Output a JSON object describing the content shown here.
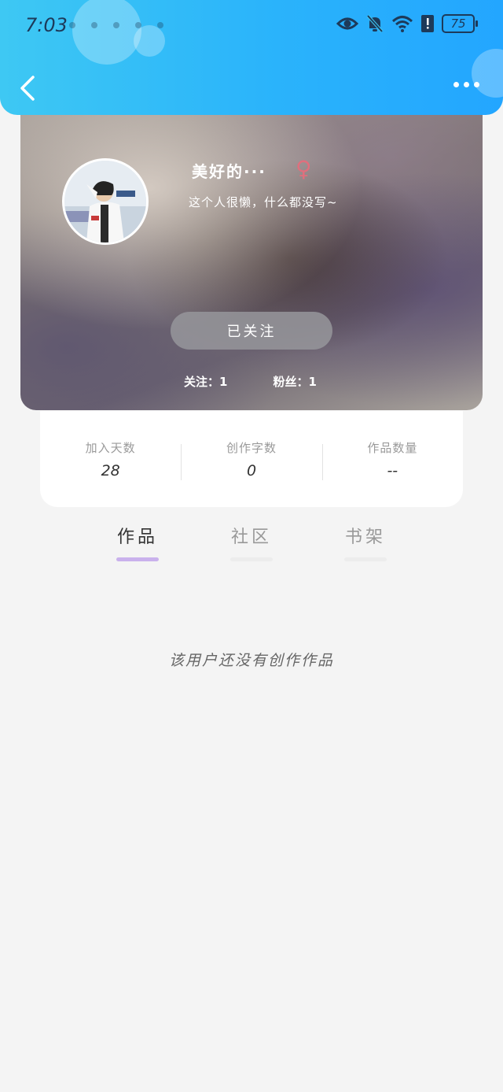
{
  "status_bar": {
    "time": "7:03",
    "battery": "75",
    "icons": [
      "eye-icon",
      "bell-off-icon",
      "wifi-icon",
      "alert-icon",
      "battery-icon"
    ]
  },
  "nav": {
    "back_icon": "chevron-left-icon",
    "more_icon": "more-horizontal-icon"
  },
  "profile": {
    "nickname": "美好的···",
    "gender_symbol": "♀",
    "bio": "这个人很懒，什么都没写~",
    "follow_button": "已关注",
    "following": "关注：1",
    "followers": "粉丝：1"
  },
  "stats": [
    {
      "label": "加入天数",
      "value": "28"
    },
    {
      "label": "创作字数",
      "value": "0"
    },
    {
      "label": "作品数量",
      "value": "--"
    }
  ],
  "tabs": [
    {
      "label": "作品",
      "active": true
    },
    {
      "label": "社区",
      "active": false
    },
    {
      "label": "书架",
      "active": false
    }
  ],
  "colors": {
    "header_gradient_start": "#3ec8f3",
    "header_gradient_end": "#23a6ff",
    "active_tab_underline": "#c9b1ec",
    "gender_color": "#e06f7d"
  },
  "empty_message": "该用户还没有创作作品"
}
